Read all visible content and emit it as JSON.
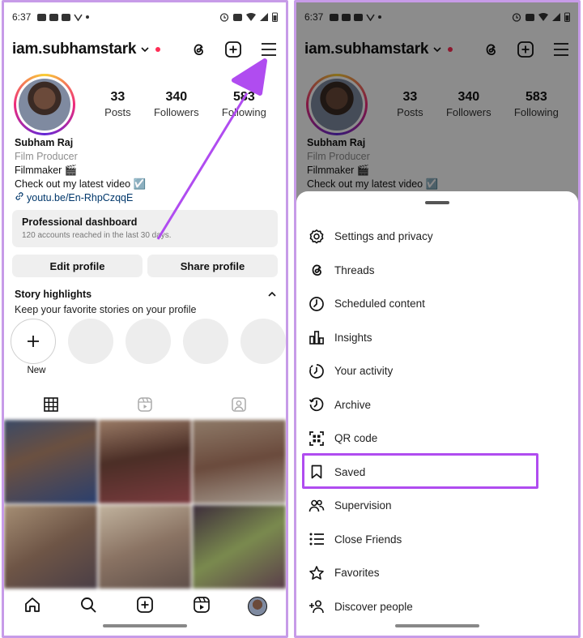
{
  "status": {
    "time": "6:37"
  },
  "header": {
    "username": "iam.subhamstark"
  },
  "profile": {
    "stats": [
      {
        "value": "33",
        "label": "Posts"
      },
      {
        "value": "340",
        "label": "Followers"
      },
      {
        "value": "583",
        "label": "Following"
      }
    ],
    "name": "Subham Raj",
    "category": "Film Producer",
    "bio_line1": "Filmmaker 🎬",
    "bio_line2": "Check out my latest video ☑️",
    "link": "youtu.be/En-RhpCzqqE"
  },
  "dashboard": {
    "title": "Professional dashboard",
    "subtitle": "120 accounts reached in the last 30 days."
  },
  "buttons": {
    "edit": "Edit profile",
    "share": "Share profile"
  },
  "highlights": {
    "title": "Story highlights",
    "subtitle": "Keep your favorite stories on your profile",
    "new_label": "New"
  },
  "menu": {
    "items": [
      {
        "label": "Settings and privacy",
        "icon": "settings-icon"
      },
      {
        "label": "Threads",
        "icon": "threads-icon"
      },
      {
        "label": "Scheduled content",
        "icon": "clock-icon"
      },
      {
        "label": "Insights",
        "icon": "insights-icon"
      },
      {
        "label": "Your activity",
        "icon": "activity-icon"
      },
      {
        "label": "Archive",
        "icon": "archive-icon"
      },
      {
        "label": "QR code",
        "icon": "qr-code-icon"
      },
      {
        "label": "Saved",
        "icon": "bookmark-icon"
      },
      {
        "label": "Supervision",
        "icon": "supervision-icon"
      },
      {
        "label": "Close Friends",
        "icon": "close-friends-icon"
      },
      {
        "label": "Favorites",
        "icon": "star-icon"
      },
      {
        "label": "Discover people",
        "icon": "add-person-icon"
      }
    ],
    "highlighted": "Saved"
  },
  "colors": {
    "annotation": "#b04cf0",
    "accent_dot": "#ff2d55",
    "link": "#00376b"
  }
}
